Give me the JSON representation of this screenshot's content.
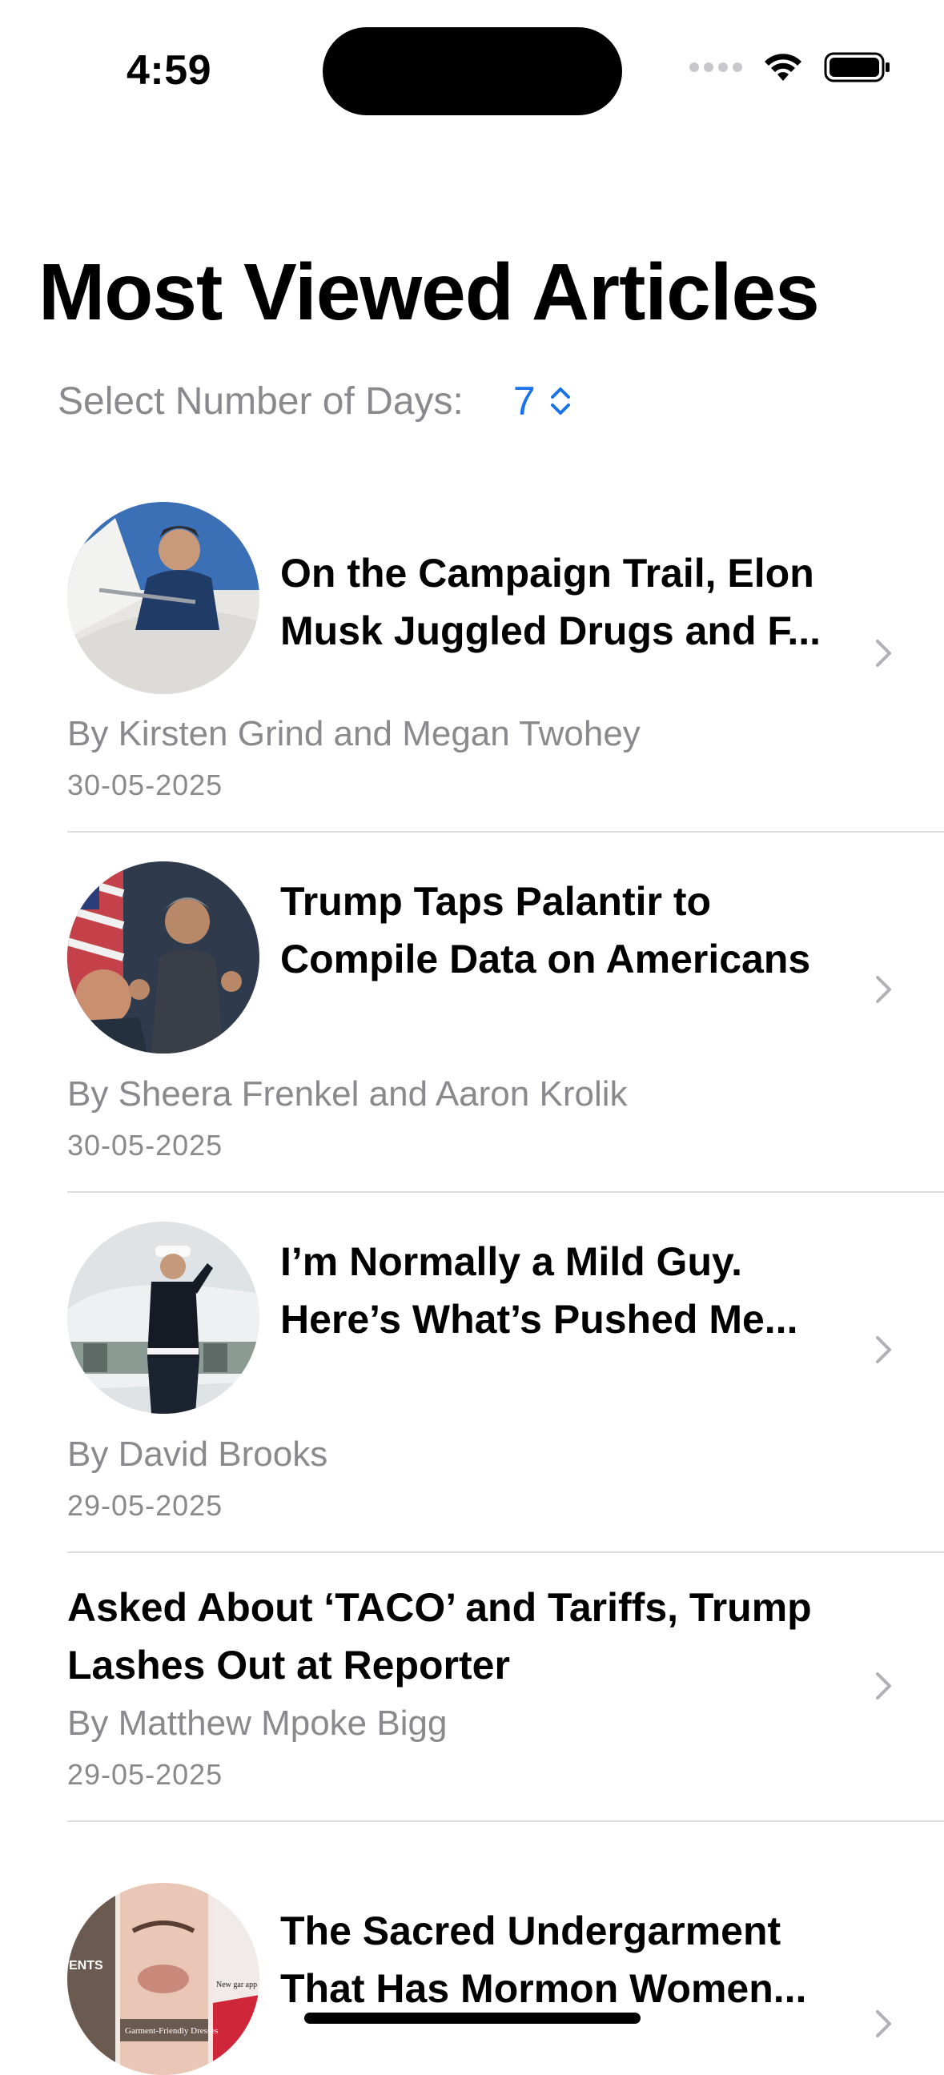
{
  "status_bar": {
    "time": "4:59"
  },
  "header": {
    "title": "Most Viewed Articles",
    "days_label": "Select Number of Days:",
    "days_value": "7"
  },
  "articles": [
    {
      "headline_line1": "On the Campaign Trail, Elon",
      "headline_line2": "Musk Juggled Drugs and F...",
      "byline": "By Kirsten Grind and Megan Twohey",
      "date": "30-05-2025",
      "has_image": true
    },
    {
      "headline_line1": "Trump Taps Palantir to",
      "headline_line2": "Compile Data on Americans",
      "byline": "By Sheera Frenkel and Aaron Krolik",
      "date": "30-05-2025",
      "has_image": true
    },
    {
      "headline_line1": "I’m Normally a Mild Guy.",
      "headline_line2": "Here’s What’s Pushed Me...",
      "byline": "By David Brooks",
      "date": "29-05-2025",
      "has_image": true
    },
    {
      "headline_line1": "Asked About ‘TACO’ and Tariffs, Trump",
      "headline_line2": "Lashes Out at Reporter",
      "byline": "By Matthew Mpoke Bigg",
      "date": "29-05-2025",
      "has_image": false
    },
    {
      "headline_line1": "The Sacred Undergarment",
      "headline_line2": "That Has Mormon Women...",
      "byline": "",
      "date": "",
      "has_image": true,
      "thumb_text1": "ENTS",
      "thumb_text2": "Garment-Friendly Dresses",
      "thumb_text3": "New gar app"
    }
  ],
  "colors": {
    "accent": "#1a73e8",
    "secondary_text": "#8a8a8e",
    "separator": "#dcdcdc"
  }
}
